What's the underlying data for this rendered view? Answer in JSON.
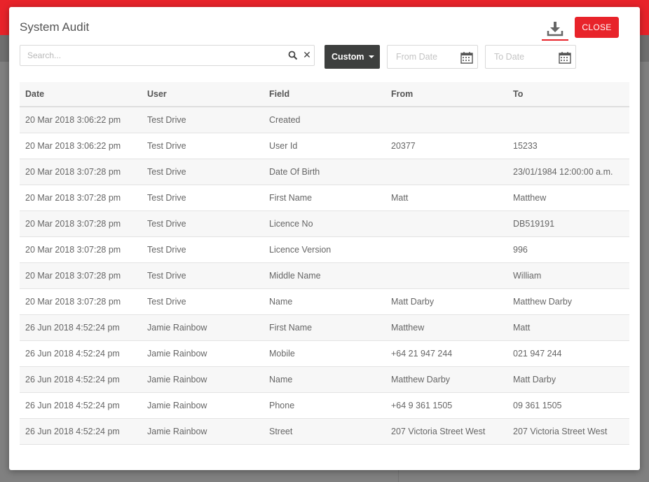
{
  "modal": {
    "title": "System Audit",
    "close_label": "CLOSE"
  },
  "search": {
    "placeholder": "Search..."
  },
  "filter": {
    "range_label": "Custom",
    "from_placeholder": "From Date",
    "to_placeholder": "To Date"
  },
  "table": {
    "headers": [
      "Date",
      "User",
      "Field",
      "From",
      "To"
    ],
    "rows": [
      [
        "20 Mar 2018 3:06:22 pm",
        "Test Drive",
        "Created",
        "",
        ""
      ],
      [
        "20 Mar 2018 3:06:22 pm",
        "Test Drive",
        "User Id",
        "20377",
        "15233"
      ],
      [
        "20 Mar 2018 3:07:28 pm",
        "Test Drive",
        "Date Of Birth",
        "",
        "23/01/1984 12:00:00 a.m."
      ],
      [
        "20 Mar 2018 3:07:28 pm",
        "Test Drive",
        "First Name",
        "Matt",
        "Matthew"
      ],
      [
        "20 Mar 2018 3:07:28 pm",
        "Test Drive",
        "Licence No",
        "",
        "DB519191"
      ],
      [
        "20 Mar 2018 3:07:28 pm",
        "Test Drive",
        "Licence Version",
        "",
        "996"
      ],
      [
        "20 Mar 2018 3:07:28 pm",
        "Test Drive",
        "Middle Name",
        "",
        "William"
      ],
      [
        "20 Mar 2018 3:07:28 pm",
        "Test Drive",
        "Name",
        "Matt Darby",
        "Matthew Darby"
      ],
      [
        "26 Jun 2018 4:52:24 pm",
        "Jamie Rainbow",
        "First Name",
        "Matthew",
        "Matt"
      ],
      [
        "26 Jun 2018 4:52:24 pm",
        "Jamie Rainbow",
        "Mobile",
        "+64 21 947 244",
        "021 947 244"
      ],
      [
        "26 Jun 2018 4:52:24 pm",
        "Jamie Rainbow",
        "Name",
        "Matthew Darby",
        "Matt Darby"
      ],
      [
        "26 Jun 2018 4:52:24 pm",
        "Jamie Rainbow",
        "Phone",
        "+64 9 361 1505",
        "09 361 1505"
      ],
      [
        "26 Jun 2018 4:52:24 pm",
        "Jamie Rainbow",
        "Street",
        "207 Victoria Street West",
        "207 Victoria Street West"
      ]
    ]
  },
  "icons": {
    "download": "download-icon",
    "search": "search-icon",
    "clear": "close-icon",
    "caret": "caret-down-icon",
    "calendar": "calendar-icon"
  },
  "colors": {
    "accent": "#e8232a",
    "dark_button": "#3d3f3e"
  }
}
